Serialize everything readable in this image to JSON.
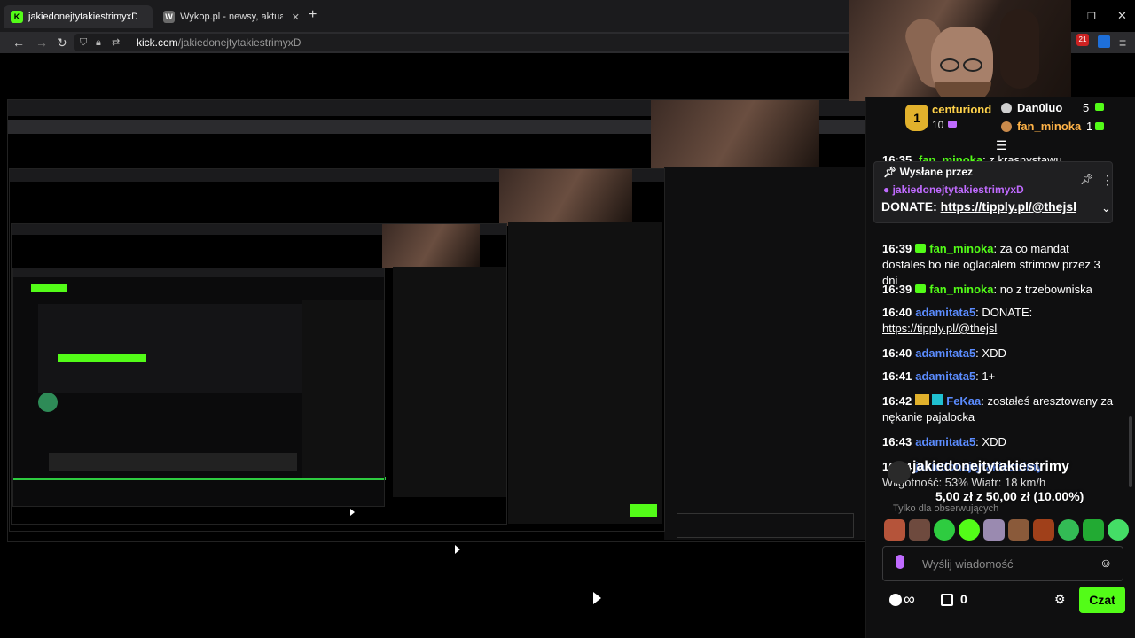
{
  "browser": {
    "tabs": [
      {
        "title": "jakiedonejtytakiestrimyxD Strea",
        "active": true
      },
      {
        "title": "Wykop.pl - newsy, aktualności,",
        "active": false
      }
    ],
    "new_tab": "+",
    "url_host": "kick.com",
    "url_path": "/jakiedonejtytakiestrimyxD",
    "badge_count": "21"
  },
  "leaderboard": {
    "first": {
      "name": "centuriond",
      "value": "10",
      "rank": "1"
    },
    "second": {
      "name": "Dan0luo",
      "value": "5"
    },
    "third": {
      "name": "fan_minoka",
      "value": "1"
    }
  },
  "chat": {
    "partial_line": {
      "time": "16:35",
      "user": "fan_minoka",
      "text": "z krasnystawu"
    },
    "pinned": {
      "header": "Wysłane przez",
      "user": "jakiedonejtytakiestrimyxD",
      "label": "DONATE:",
      "link": "https://tipply.pl/@thejsl"
    },
    "messages": [
      {
        "time": "16:39",
        "user": "fan_minoka",
        "sep": ":",
        "text": "za co mandat dostales bo nie ogladalem strimow przez 3 dni"
      },
      {
        "time": "16:39",
        "user": "fan_minoka",
        "sep": ":",
        "text": "no z trzebowniska"
      },
      {
        "time": "16:40",
        "user": "adamitata5",
        "sep": ":",
        "text": "DONATE:",
        "link": "https://tipply.pl/@thejsl"
      },
      {
        "time": "16:40",
        "user": "adamitata5",
        "sep": ":",
        "text": "XDD"
      },
      {
        "time": "16:41",
        "user": "adamitata5",
        "sep": ":",
        "text": "1+"
      },
      {
        "time": "16:42",
        "user": "FeKaa",
        "sep": ":",
        "text": "zostałeś aresztowany za nękanie pajalocka"
      },
      {
        "time": "16:43",
        "user": "adamitata5",
        "sep": ":",
        "text": "XDD"
      },
      {
        "time": "16:44",
        "user": "jakiedonejtytakiestrimy",
        "sep": "",
        "text": "Wilgotność: 53% Wiatr: 18 km/h"
      }
    ],
    "donation": {
      "title": "jakiedonejtytakiestrimy",
      "amount": "5,00 zł z 50,00 zł (10.00%)",
      "sub": "Tylko dla obserwujących"
    },
    "input_placeholder": "Wyślij wiadomość",
    "points": "∞",
    "gift_count": "0",
    "send_label": "Czat"
  },
  "colors": {
    "accent": "#53fc18",
    "user_blue": "#5b8cff",
    "panel": "#0f0f10"
  }
}
